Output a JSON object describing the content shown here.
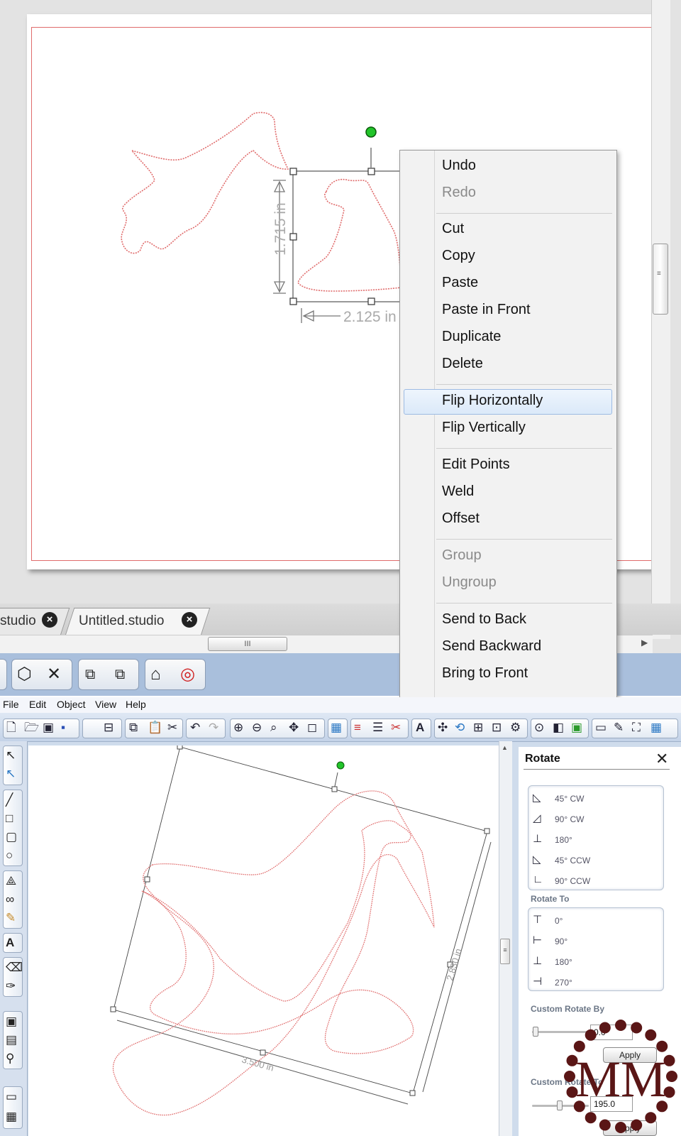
{
  "top": {
    "dimensions": {
      "height": "1.715 in",
      "width": "2.125 in"
    },
    "tabs": [
      {
        "label": "studio"
      },
      {
        "label": "Untitled.studio"
      }
    ],
    "context_menu": {
      "items": [
        {
          "label": "Undo"
        },
        {
          "label": "Redo",
          "disabled": true
        },
        {
          "label": "Cut"
        },
        {
          "label": "Copy"
        },
        {
          "label": "Paste"
        },
        {
          "label": "Paste in Front"
        },
        {
          "label": "Duplicate"
        },
        {
          "label": "Delete"
        },
        {
          "label": "Flip Horizontally",
          "highlighted": true
        },
        {
          "label": "Flip Vertically"
        },
        {
          "label": "Edit Points"
        },
        {
          "label": "Weld"
        },
        {
          "label": "Offset"
        },
        {
          "label": "Group",
          "disabled": true
        },
        {
          "label": "Ungroup",
          "disabled": true
        },
        {
          "label": "Send to Back"
        },
        {
          "label": "Send Backward"
        },
        {
          "label": "Bring to Front"
        }
      ]
    }
  },
  "bottom": {
    "menubar": [
      "File",
      "Edit",
      "Object",
      "View",
      "Help"
    ],
    "dimensions": {
      "width": "3.500 in",
      "height": "2.830 in"
    },
    "rotate_panel": {
      "title": "Rotate",
      "rotate_by": [
        {
          "label": "45° CW",
          "icon": "rotate-45-cw-icon"
        },
        {
          "label": "90° CW",
          "icon": "rotate-90-cw-icon"
        },
        {
          "label": "180°",
          "icon": "rotate-180-icon"
        },
        {
          "label": "45° CCW",
          "icon": "rotate-45-ccw-icon"
        },
        {
          "label": "90° CCW",
          "icon": "rotate-90-ccw-icon"
        }
      ],
      "rotate_to_label": "Rotate To",
      "rotate_to": [
        {
          "label": "0°",
          "icon": "rotate-to-0-icon"
        },
        {
          "label": "90°",
          "icon": "rotate-to-90-icon"
        },
        {
          "label": "180°",
          "icon": "rotate-to-180-icon"
        },
        {
          "label": "270°",
          "icon": "rotate-to-270-icon"
        }
      ],
      "custom_by_label": "Custom Rotate By",
      "custom_by_value": "0.0",
      "custom_by_unit": "°",
      "apply_label": "Apply",
      "custom_to_label": "Custom Rotate To",
      "custom_to_value": "195.0"
    },
    "logo_text": "MM"
  },
  "colors": {
    "cut_line": "#e06c6c",
    "rotate_handle": "#22c42a",
    "logo": "#5a1616",
    "toolbar_blue": "#a9bfdc"
  }
}
